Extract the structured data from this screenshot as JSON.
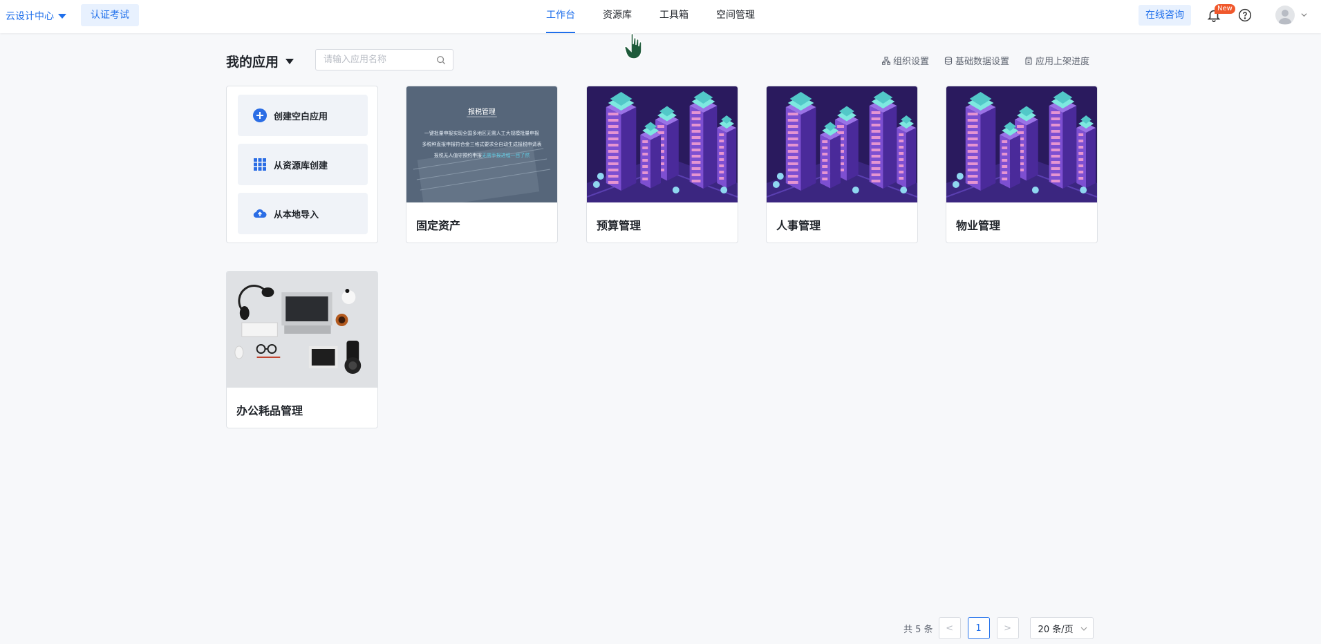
{
  "topbar": {
    "brand_label": "云设计中心",
    "exam_label": "认证考试",
    "nav": [
      {
        "label": "工作台",
        "active": true
      },
      {
        "label": "资源库",
        "active": false
      },
      {
        "label": "工具箱",
        "active": false
      },
      {
        "label": "空间管理",
        "active": false
      }
    ],
    "consult_label": "在线咨询",
    "new_badge": "New",
    "icons": [
      "bell-icon",
      "help-icon",
      "avatar-icon",
      "chevron-down-icon"
    ]
  },
  "section": {
    "title": "我的应用",
    "search_placeholder": "请输入应用名称",
    "links": [
      {
        "label": "组织设置",
        "icon": "org-icon"
      },
      {
        "label": "基础数据设置",
        "icon": "database-icon"
      },
      {
        "label": "应用上架进度",
        "icon": "shelf-icon"
      }
    ]
  },
  "create_panel": {
    "buttons": [
      {
        "label": "创建空白应用",
        "icon": "plus-circle-icon"
      },
      {
        "label": "从资源库创建",
        "icon": "grid-icon"
      },
      {
        "label": "从本地导入",
        "icon": "cloud-upload-icon"
      }
    ]
  },
  "apps": [
    {
      "name": "固定资产",
      "thumb": "tax",
      "thumb_title": "报税管理",
      "thumb_lines": [
        "一键批量申报实现全国多地区无需人工大规模批量申报",
        "多税种直报申报符合金三格式要求全自动生成报税申请表",
        "报税无人值守预约申报"
      ],
      "thumb_highlight": "无需手报进程一目了然"
    },
    {
      "name": "预算管理",
      "thumb": "city"
    },
    {
      "name": "人事管理",
      "thumb": "city"
    },
    {
      "name": "物业管理",
      "thumb": "city"
    },
    {
      "name": "办公耗品管理",
      "thumb": "desk"
    }
  ],
  "pagination": {
    "total_label": "共 5 条",
    "current_page": "1",
    "prev": "<",
    "next": ">",
    "page_size_label": "20 条/页"
  },
  "colors": {
    "accent": "#1f6feb",
    "badge": "#f0582c",
    "city_bg": "#2a1a5e"
  }
}
